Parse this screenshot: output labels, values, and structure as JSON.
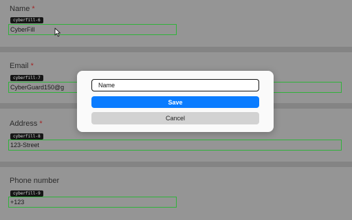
{
  "form": {
    "required_marker": "*",
    "fields": [
      {
        "label": "Name",
        "required": true,
        "badge": "cyberfill-6",
        "value": "CyberFill"
      },
      {
        "label": "Email",
        "required": true,
        "badge": "cyberfill-7",
        "value": "CyberGuard150@g"
      },
      {
        "label": "Address",
        "required": true,
        "badge": "cyberfill-8",
        "value": "123-Street"
      },
      {
        "label": "Phone number",
        "required": false,
        "badge": "cyberfill-9",
        "value": "+123"
      }
    ]
  },
  "dialog": {
    "input_value": "Name",
    "save_label": "Save",
    "cancel_label": "Cancel"
  },
  "colors": {
    "field_highlight": "#2fb33a",
    "primary_button": "#0a7cff",
    "required_marker": "#a32626"
  },
  "icons": {
    "pointer": "mouse-pointer-icon"
  }
}
